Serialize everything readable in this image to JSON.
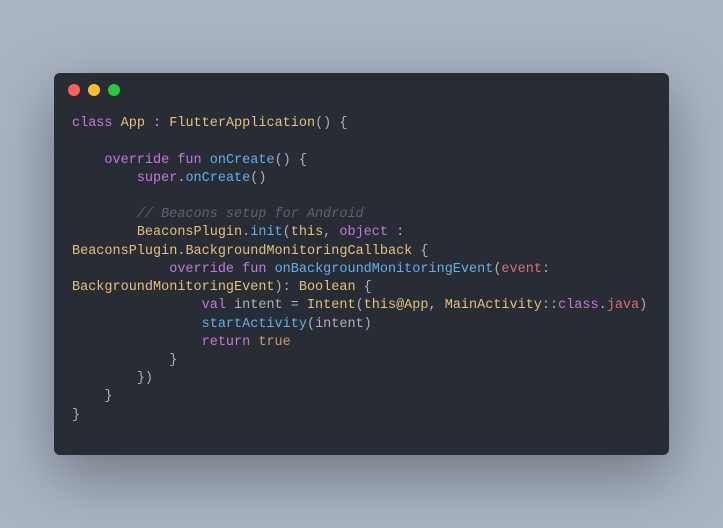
{
  "code": {
    "line1_class": "class",
    "line1_App": "App",
    "line1_colon": " : ",
    "line1_FlutterApplication": "FlutterApplication",
    "line1_paren_open": "() {",
    "line3_indent": "    ",
    "line3_override": "override",
    "line3_fun": "fun",
    "line3_onCreate": "onCreate",
    "line3_paren": "() {",
    "line4_indent": "        ",
    "line4_super": "super",
    "line4_dot": ".",
    "line4_onCreate": "onCreate",
    "line4_paren": "()",
    "line6_indent": "        ",
    "line6_comment": "// Beacons setup for Android",
    "line7_indent": "        ",
    "line7_BeaconsPlugin": "BeaconsPlugin",
    "line7_dot": ".",
    "line7_init": "init",
    "line7_open": "(",
    "line7_this": "this",
    "line7_comma": ", ",
    "line7_object": "object",
    "line7_colon2": " : ",
    "line7b_BeaconsPlugin": "BeaconsPlugin",
    "line7b_dot": ".",
    "line7b_BackgroundMonitoringCallback": "BackgroundMonitoringCallback",
    "line7b_brace": " {",
    "line8_indent": "            ",
    "line8_override": "override",
    "line8_fun": "fun",
    "line8_onBackgroundMonitoringEvent": "onBackgroundMonitoringEvent",
    "line8_open": "(",
    "line8_event": "event",
    "line8_colon": ": ",
    "line8b_BackgroundMonitoringEvent": "BackgroundMonitoringEvent",
    "line8b_close": ")",
    "line8b_colon": ": ",
    "line8b_Boolean": "Boolean",
    "line8b_brace": " {",
    "line9_indent": "                ",
    "line9_val": "val",
    "line9_intent": " intent ",
    "line9_eq": "= ",
    "line9_Intent": "Intent",
    "line9_open": "(",
    "line9_this": "this",
    "line9_at": "@App",
    "line9_comma": ", ",
    "line9b_MainActivity": "MainActivity",
    "line9b_colcol": "::",
    "line9b_class": "class",
    "line9b_dot": ".",
    "line9b_java": "java",
    "line9b_close": ")",
    "line10_indent": "                ",
    "line10_startActivity": "startActivity",
    "line10_open": "(",
    "line10_intent": "intent",
    "line10_close": ")",
    "line11_indent": "                ",
    "line11_return": "return",
    "line11_sp": " ",
    "line11_true": "true",
    "line12_indent": "            ",
    "line12_brace": "}",
    "line13_indent": "        ",
    "line13_brace": "})",
    "line14_indent": "    ",
    "line14_brace": "}",
    "line15_brace": "}"
  }
}
